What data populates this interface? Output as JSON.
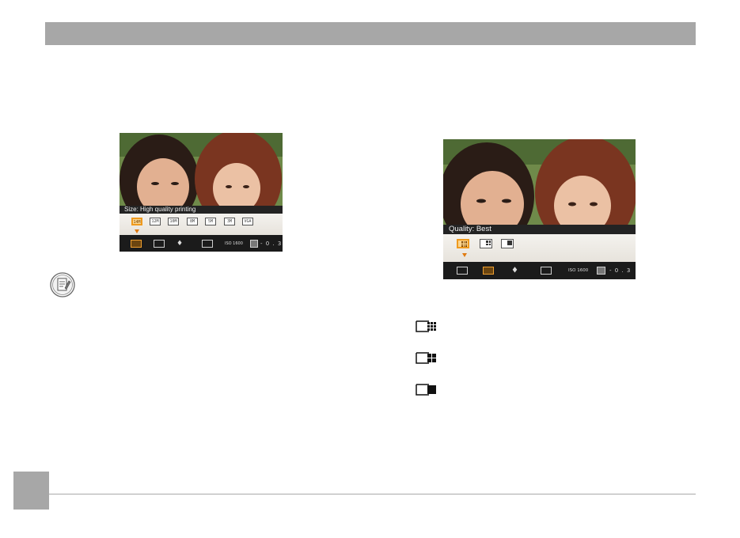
{
  "screen_left": {
    "caption": "Size: High quality printing",
    "options": [
      "14M",
      "12M",
      "10M",
      "8M",
      "5M",
      "3M",
      "VGA"
    ],
    "status": {
      "iso": "ISO 1600",
      "exposure": "- 0 . 3"
    }
  },
  "screen_right": {
    "caption": "Quality: Best",
    "options": [
      "Best",
      "Fine",
      "Normal"
    ],
    "status": {
      "iso": "ISO 1600",
      "exposure": "- 0 . 3"
    }
  },
  "legend_icons": [
    "quality-best-icon",
    "quality-fine-icon",
    "quality-normal-icon"
  ],
  "colors": {
    "header": "#a7a7a7",
    "selection": "#ef9a1e"
  }
}
